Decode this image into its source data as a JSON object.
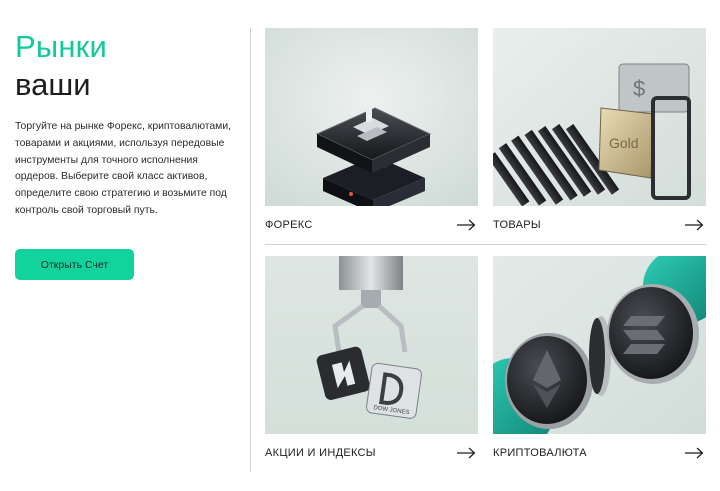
{
  "intro": {
    "title_accent": "Рынки",
    "title_main": "ваши",
    "description": "Торгуйте на рынке Форекс, криптовалютами, товарами и акциями, используя передовые инструменты для точного исполнения ордеров. Выберите свой класс активов, определите свою стратегию и возьмите под контроль свой торговый путь.",
    "cta_label": "Открыть Счет"
  },
  "markets": [
    {
      "label": "ФОРЕКС",
      "icon": "arrow-right-icon"
    },
    {
      "label": "ТОВАРЫ",
      "icon": "arrow-right-icon",
      "image_text": "Gold"
    },
    {
      "label": "АКЦИИ И ИНДЕКСЫ",
      "icon": "arrow-right-icon",
      "image_text": "DOW JONES"
    },
    {
      "label": "КРИПТОВАЛЮТА",
      "icon": "arrow-right-icon"
    }
  ],
  "colors": {
    "accent": "#12c99b",
    "button": "#12d39e",
    "tile_bg": "#dfe7e4",
    "crypto_teal": "#1fb8a4"
  }
}
